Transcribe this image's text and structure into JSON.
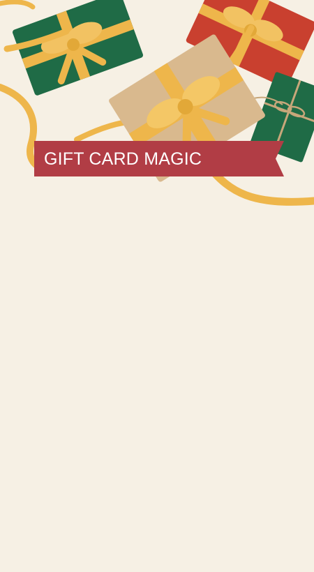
{
  "banner": {
    "title": "GIFT CARD MAGIC",
    "color": "#b13d45"
  },
  "hero": {
    "image": "wrapped-gift-boxes-with-gold-ribbons",
    "colors": {
      "background": "#f6f0e4",
      "ribbon": "#eeb64b",
      "green_wrap": "#1f6b46",
      "red_wrap": "#c9402f",
      "kraft_wrap": "#d9b98e",
      "twine": "#c7a77a"
    }
  }
}
